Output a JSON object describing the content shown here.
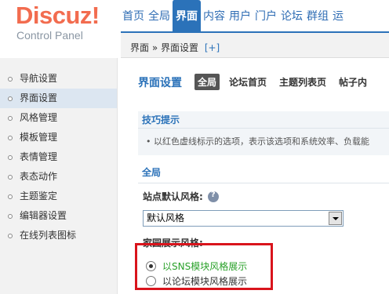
{
  "logo": {
    "brand": "Discuz!",
    "subtitle": "Control Panel"
  },
  "topnav": [
    "首页",
    "全局",
    "界面",
    "内容",
    "用户",
    "门户",
    "论坛",
    "群组",
    "运"
  ],
  "topnav_active": "界面",
  "breadcrumb": {
    "path": "界面 » 界面设置",
    "action": "[+]"
  },
  "sidebar": {
    "items": [
      "导航设置",
      "界面设置",
      "风格管理",
      "模板管理",
      "表情管理",
      "表态动作",
      "主题鉴定",
      "编辑器设置",
      "在线列表图标"
    ],
    "active": "界面设置"
  },
  "main": {
    "title": "界面设置",
    "tabs": [
      "全局",
      "论坛首页",
      "主题列表页",
      "帖子内"
    ],
    "active_tab": "全局"
  },
  "tips": {
    "heading": "技巧提示",
    "text": "以红色虚线标示的选项，表示该选项和系统效率、负载能"
  },
  "section": {
    "heading": "全局"
  },
  "fields": {
    "default_style": {
      "label": "站点默认风格:",
      "value": "默认风格"
    },
    "home_display": {
      "label": "家园展示风格:",
      "options": [
        "以SNS模块风格展示",
        "以论坛模块风格展示"
      ],
      "selected": "以SNS模块风格展示"
    }
  },
  "colors": {
    "accent": "#2b72b9",
    "brand": "#f26c4f",
    "highlight": "#d9141c",
    "selected_option": "#2aa12a"
  },
  "icons": {
    "help": "question-mark-icon",
    "select_arrow": "chevron-down-icon",
    "bullet": "circle-bullet-icon"
  }
}
